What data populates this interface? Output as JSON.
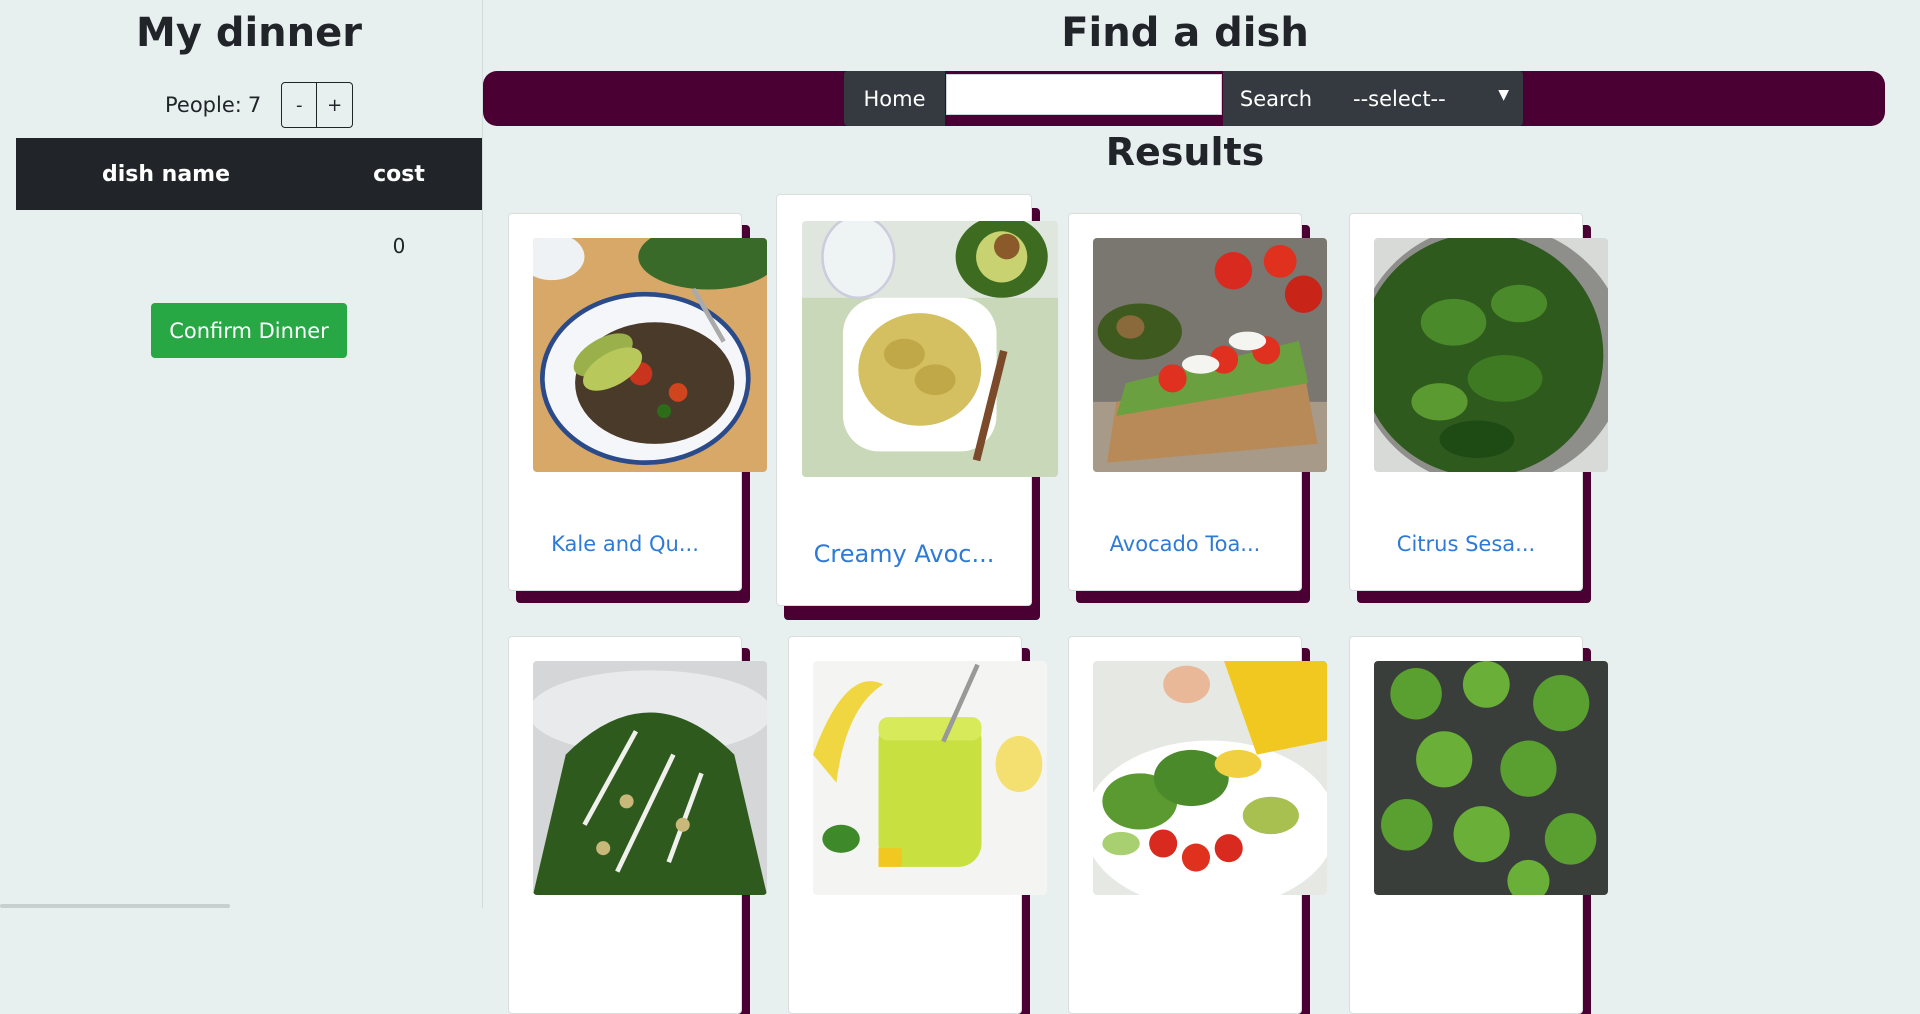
{
  "sidebar": {
    "title": "My dinner",
    "people_label": "People:",
    "people_count": "7",
    "minus_label": "-",
    "plus_label": "+",
    "table": {
      "col_name": "dish name",
      "col_cost": "cost",
      "total_name": "",
      "total_cost": "0"
    },
    "confirm_label": "Confirm Dinner"
  },
  "main": {
    "title": "Find a dish",
    "nav": {
      "home_label": "Home",
      "search_value": "",
      "search_label": "Search",
      "type_select_value": "--select--"
    },
    "results_title": "Results",
    "dishes": [
      {
        "label": "Kale and Qu..."
      },
      {
        "label": "Creamy Avoc..."
      },
      {
        "label": "Avocado Toa..."
      },
      {
        "label": "Citrus Sesa..."
      },
      {
        "label": ""
      },
      {
        "label": ""
      },
      {
        "label": ""
      },
      {
        "label": ""
      }
    ]
  },
  "colors": {
    "accent": "#4a0033",
    "confirm": "#28a745",
    "link": "#2e7ad6",
    "dark": "#212529"
  }
}
